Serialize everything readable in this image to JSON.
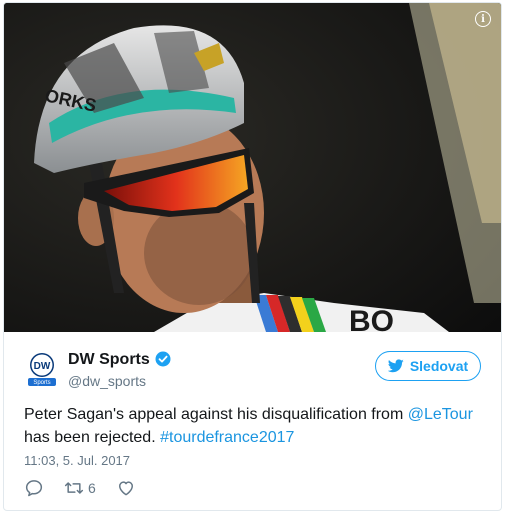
{
  "tweet": {
    "author": {
      "display_name": "DW Sports",
      "handle": "@dw_sports",
      "avatar_text": "DW",
      "avatar_sub": "Sports"
    },
    "follow_label": "Sledovat",
    "text": {
      "part1": "Peter Sagan's appeal against his disqualification from ",
      "mention": "@LeTour",
      "part2": " has been rejected. ",
      "hashtag": "#tourdefrance2017"
    },
    "timestamp": "11:03, 5. Jul. 2017",
    "retweet_count": "6",
    "media": {
      "helmet_text": "ORKS",
      "jersey_text": "BO"
    }
  },
  "icons": {
    "info": "info-icon",
    "verified": "verified-badge-icon",
    "twitter_bird": "twitter-bird-icon",
    "reply": "reply-icon",
    "retweet": "retweet-icon",
    "like": "heart-icon"
  },
  "colors": {
    "accent": "#1da1f2",
    "link": "#1b95e0",
    "text": "#14171a",
    "muted": "#657786",
    "border": "#e1e8ed"
  }
}
